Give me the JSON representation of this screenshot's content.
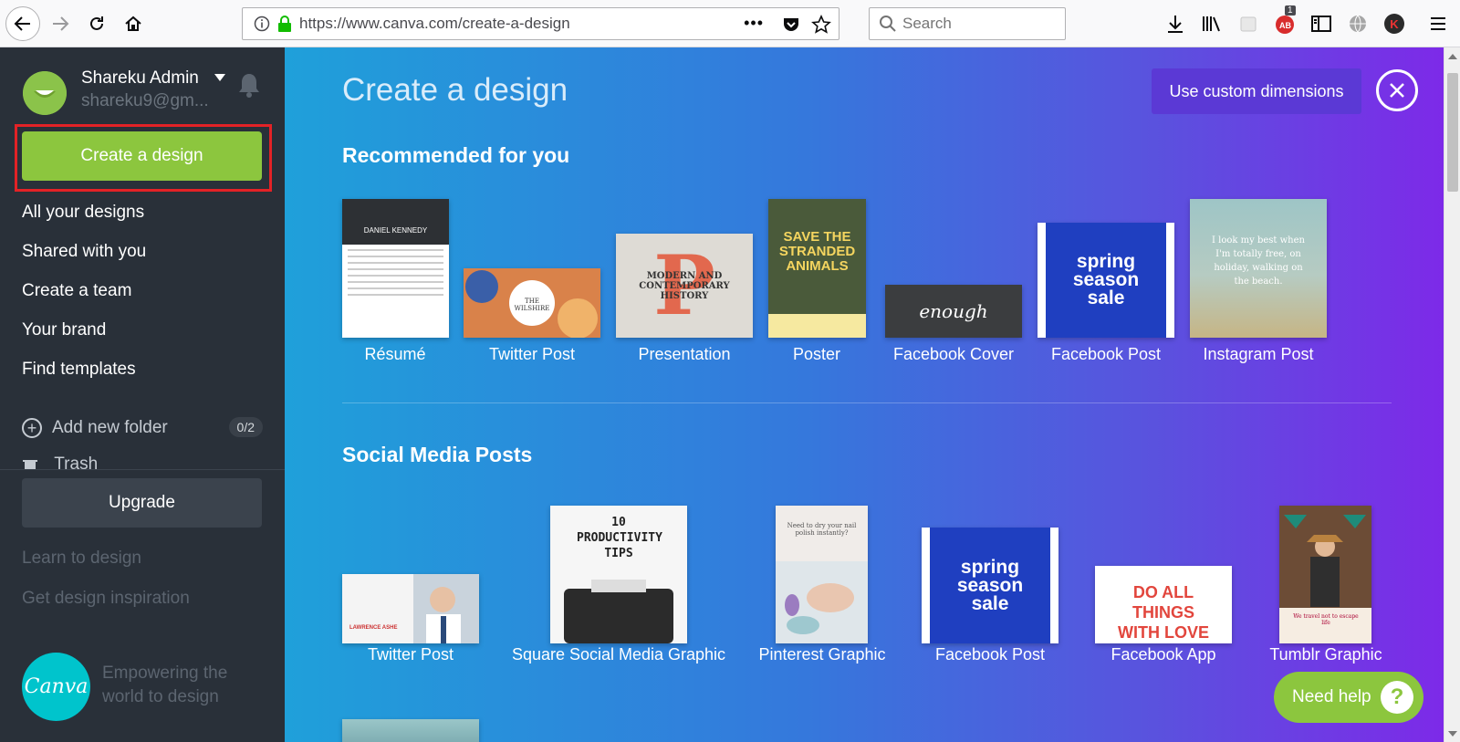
{
  "browser": {
    "url": "https://www.canva.com/create-a-design",
    "url_more": "•••",
    "search_placeholder": "Search",
    "addon_badge": "1",
    "profile_initial": "K"
  },
  "sidebar": {
    "user_name": "Shareku Admin",
    "user_email": "shareku9@gm...",
    "create_label": "Create a design",
    "nav": [
      {
        "label": "All your designs"
      },
      {
        "label": "Shared with you"
      },
      {
        "label": "Create a team"
      },
      {
        "label": "Your brand"
      },
      {
        "label": "Find templates"
      }
    ],
    "add_folder_label": "Add new folder",
    "folder_count": "0/2",
    "trash_label": "Trash",
    "upgrade_label": "Upgrade",
    "learn_label": "Learn to design",
    "inspiration_label": "Get design inspiration",
    "logo_text": "Canva",
    "tagline": "Empowering the world to design"
  },
  "main": {
    "title": "Create a design",
    "custom_dimensions_label": "Use custom dimensions",
    "recommended_title": "Recommended for you",
    "recommended": [
      {
        "label": "Résumé",
        "thumb_text": "DANIEL KENNEDY"
      },
      {
        "label": "Twitter Post",
        "thumb_text": "THE WILSHIRE"
      },
      {
        "label": "Presentation",
        "thumb_text": "MODERN AND CONTEMPORARY HISTORY"
      },
      {
        "label": "Poster",
        "thumb_text": "SAVE THE STRANDED ANIMALS"
      },
      {
        "label": "Facebook Cover",
        "thumb_text": "enough"
      },
      {
        "label": "Facebook Post",
        "thumb_text": "spring season sale"
      },
      {
        "label": "Instagram Post",
        "thumb_text": "I look my best when I'm totally free, on holiday, walking on the beach."
      }
    ],
    "social_title": "Social Media Posts",
    "social": [
      {
        "label": "Twitter Post",
        "thumb_text": "LAWRENCE ASHE"
      },
      {
        "label": "Square Social Media Graphic",
        "thumb_text": "10 PRODUCTIVITY TIPS"
      },
      {
        "label": "Pinterest Graphic",
        "thumb_text": "Need to dry your nail polish instantly?"
      },
      {
        "label": "Facebook Post",
        "thumb_text": "spring season sale"
      },
      {
        "label": "Facebook App",
        "thumb_text": "DO ALL THINGS WITH LOVE"
      },
      {
        "label": "Tumblr Graphic",
        "thumb_text": "We travel not to escape life"
      }
    ]
  },
  "help": {
    "label": "Need help",
    "icon_text": "?"
  }
}
